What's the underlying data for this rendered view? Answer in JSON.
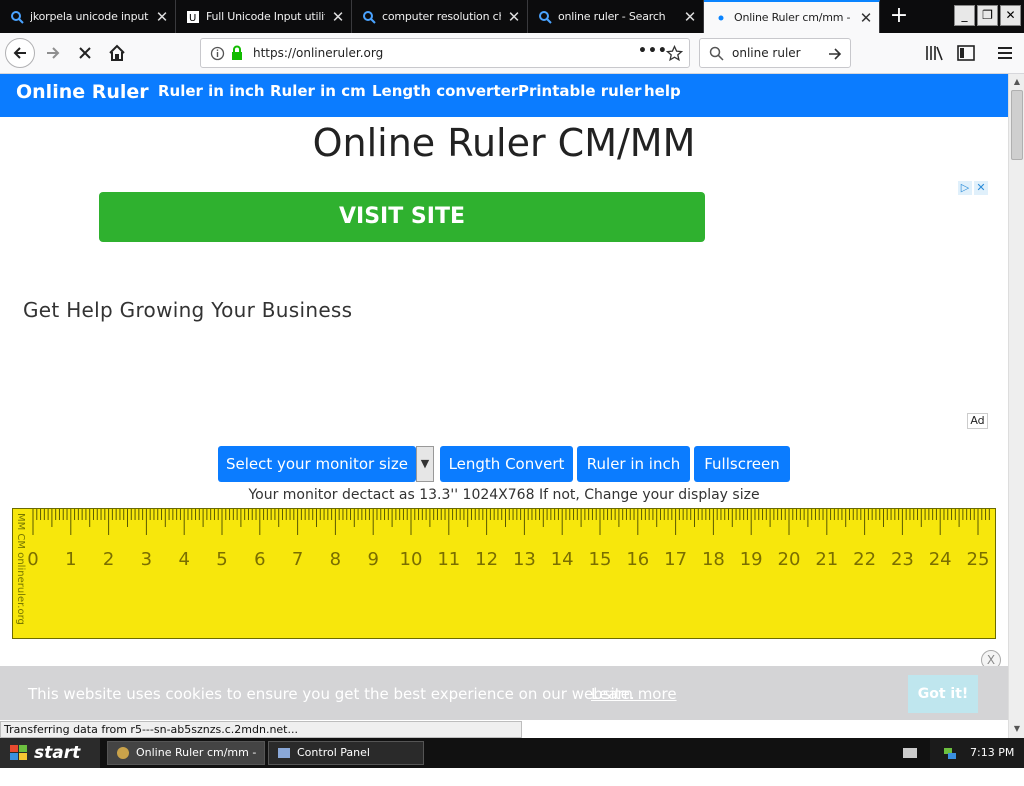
{
  "browser": {
    "tabs": [
      {
        "title": "jkorpela unicode input -",
        "active": false
      },
      {
        "title": "Full Unicode Input utility",
        "active": false
      },
      {
        "title": "computer resolution che",
        "active": false
      },
      {
        "title": "online ruler - Search",
        "active": false
      },
      {
        "title": "Online Ruler cm/mm - O",
        "active": true
      }
    ],
    "new_tab": "+",
    "url": "https://onlineruler.org",
    "search_value": "online ruler",
    "window_controls": [
      "minimize",
      "restore",
      "close"
    ]
  },
  "site": {
    "brand": "Online Ruler",
    "nav": [
      "Ruler in inch",
      "Ruler in cm",
      "Length converter",
      "Printable ruler",
      "help"
    ],
    "page_title": "Online Ruler CM/MM",
    "ad": {
      "button": "VISIT SITE",
      "headline": "Get Help Growing Your Business",
      "badge": "Ad"
    },
    "buttons": {
      "select_monitor": "Select your monitor size",
      "length_convert": "Length Convert",
      "ruler_inch": "Ruler in inch",
      "fullscreen": "Fullscreen"
    },
    "monitor_text": "Your monitor dectact as 13.3'' 1024X768 If not, Change your display size",
    "ruler": {
      "side_label": "MM CM  onlineruler.org",
      "numbers": [
        "0",
        "1",
        "2",
        "3",
        "4",
        "5",
        "6",
        "7",
        "8",
        "9",
        "10",
        "11",
        "12",
        "13",
        "14",
        "15",
        "16",
        "17",
        "18",
        "19",
        "20",
        "21",
        "22",
        "23",
        "24",
        "25"
      ],
      "color": "#f7e70c"
    },
    "cookie": {
      "text": "This website uses cookies to ensure you get the best experience on our website.",
      "learn_more": "Learn more",
      "got_it": "Got it!",
      "close": "X"
    }
  },
  "status_bar": "Transferring data from r5---sn-ab5sznzs.c.2mdn.net...",
  "taskbar": {
    "start": "start",
    "items": [
      {
        "label": "Online Ruler cm/mm - ...",
        "active": true
      },
      {
        "label": "Control Panel",
        "active": false
      }
    ],
    "clock": "7:13 PM"
  },
  "colors": {
    "site_blue": "#0b7cff",
    "ad_green": "#2fb12f",
    "ruler_yellow": "#f7e70c"
  }
}
